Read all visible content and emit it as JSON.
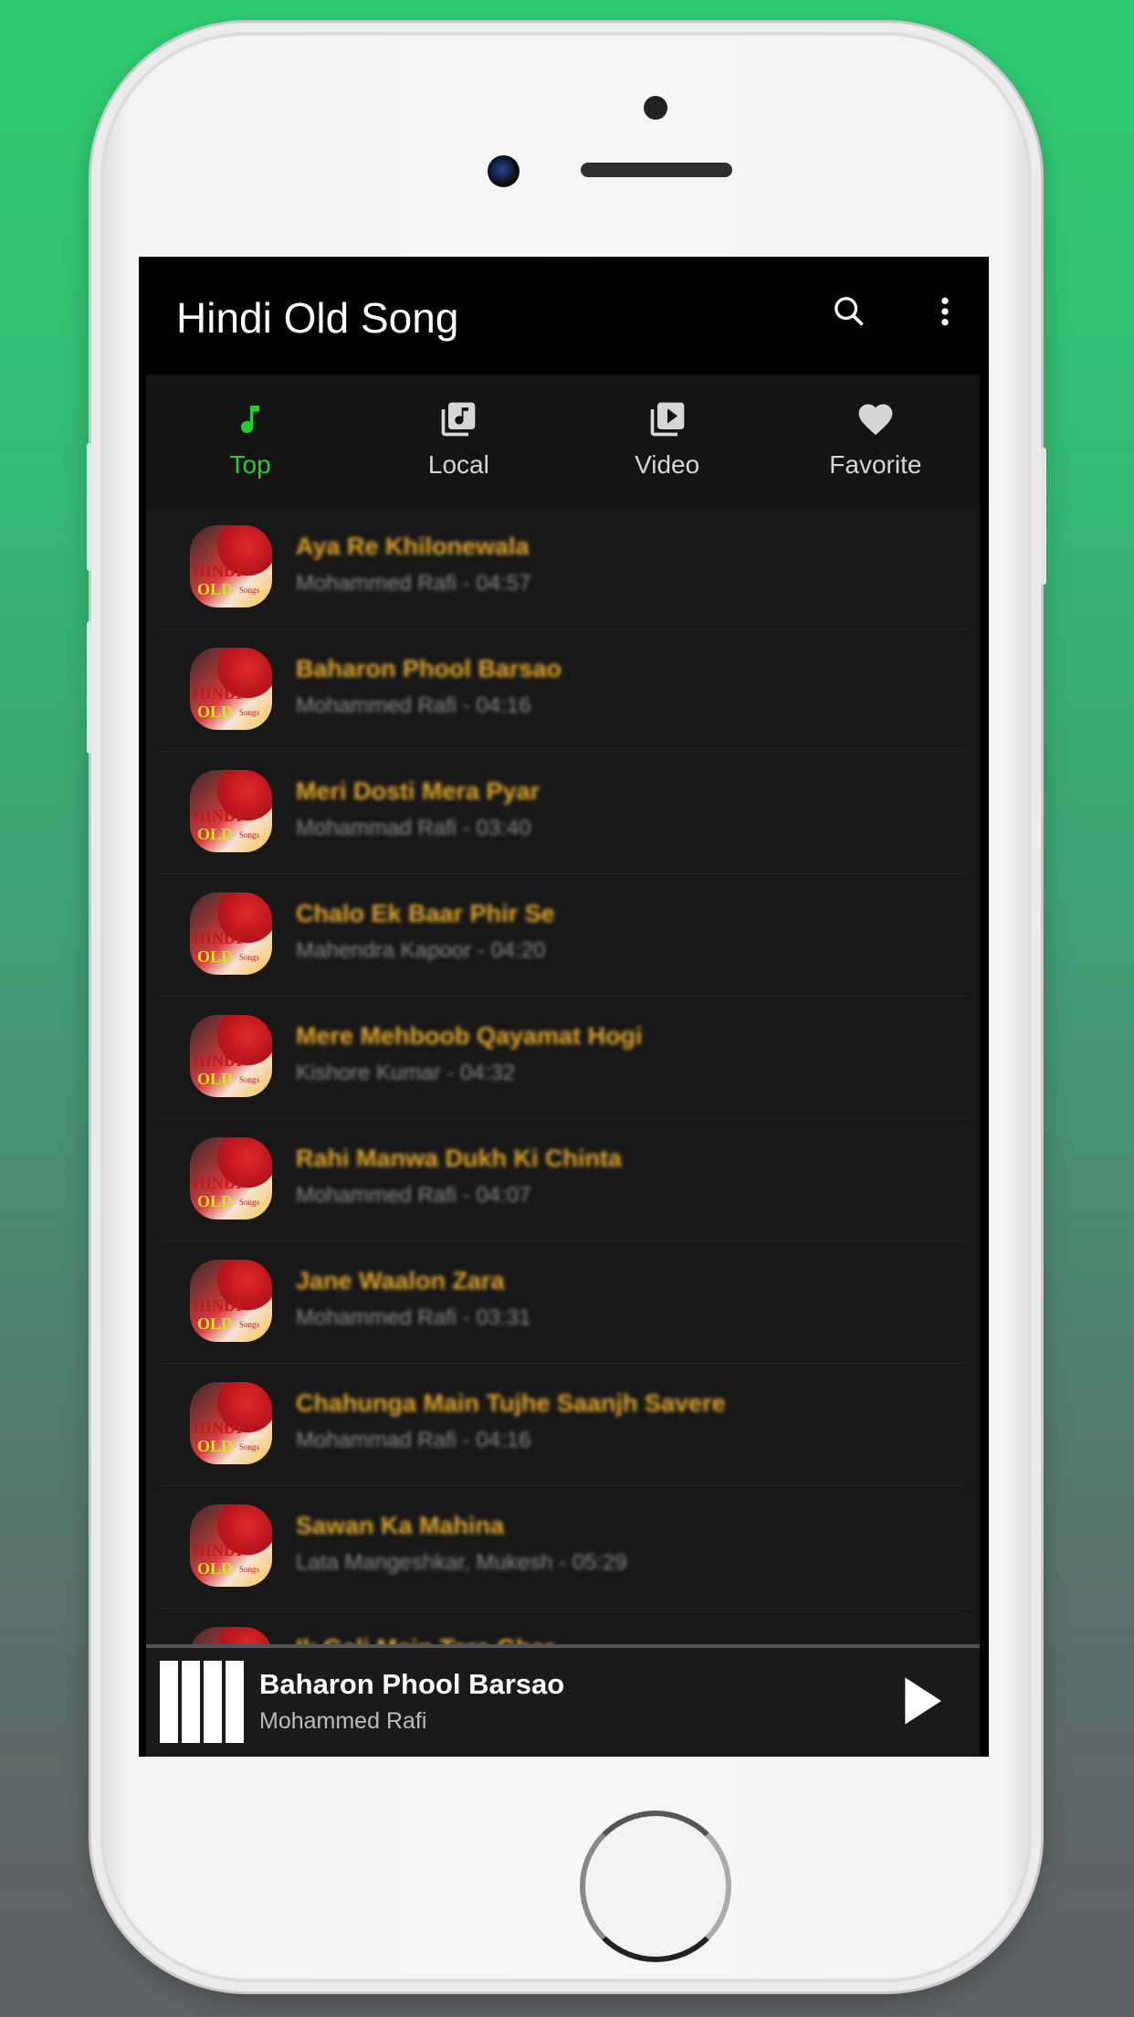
{
  "app": {
    "title": "Hindi Old Song",
    "actions": [
      {
        "name": "search",
        "icon": "search-icon"
      },
      {
        "name": "more",
        "icon": "more-vert-icon"
      }
    ]
  },
  "colors": {
    "accent": "#22d02a",
    "song_title": "#e2a72c",
    "background_top": "#2ecc71",
    "background_bottom": "#5f6264"
  },
  "tabs": [
    {
      "label": "Top",
      "icon": "music-note-icon",
      "active": true
    },
    {
      "label": "Local",
      "icon": "library-music-icon",
      "active": false
    },
    {
      "label": "Video",
      "icon": "video-library-icon",
      "active": false
    },
    {
      "label": "Favorite",
      "icon": "heart-icon",
      "active": false
    }
  ],
  "songs": [
    {
      "title": "Aya Re Khilonewala",
      "subtitle": "Mohammed Rafi - 04:57"
    },
    {
      "title": "Baharon Phool Barsao",
      "subtitle": "Mohammed Rafi - 04:16"
    },
    {
      "title": "Meri Dosti Mera Pyar",
      "subtitle": "Mohammad Rafi - 03:40"
    },
    {
      "title": "Chalo Ek Baar Phir Se",
      "subtitle": "Mahendra Kapoor - 04:20"
    },
    {
      "title": "Mere Mehboob Qayamat Hogi",
      "subtitle": "Kishore Kumar - 04:32"
    },
    {
      "title": "Rahi Manwa Dukh Ki Chinta",
      "subtitle": "Mohammed Rafi - 04:07"
    },
    {
      "title": "Jane Waalon Zara",
      "subtitle": "Mohammed Rafi - 03:31"
    },
    {
      "title": "Chahunga Main Tujhe Saanjh Savere",
      "subtitle": "Mohammad Rafi - 04:16"
    },
    {
      "title": "Sawan Ka Mahina",
      "subtitle": "Lata Mangeshkar, Mukesh - 05:29"
    },
    {
      "title": "Ik Gali Mein Tera Ghar",
      "subtitle": ""
    }
  ],
  "avatar_text": {
    "line1": "HINDI",
    "line2": "OLD",
    "line3": "Songs"
  },
  "player": {
    "title": "Baharon Phool Barsao",
    "artist": "Mohammed Rafi",
    "state": "paused",
    "play_icon": "play-icon"
  }
}
